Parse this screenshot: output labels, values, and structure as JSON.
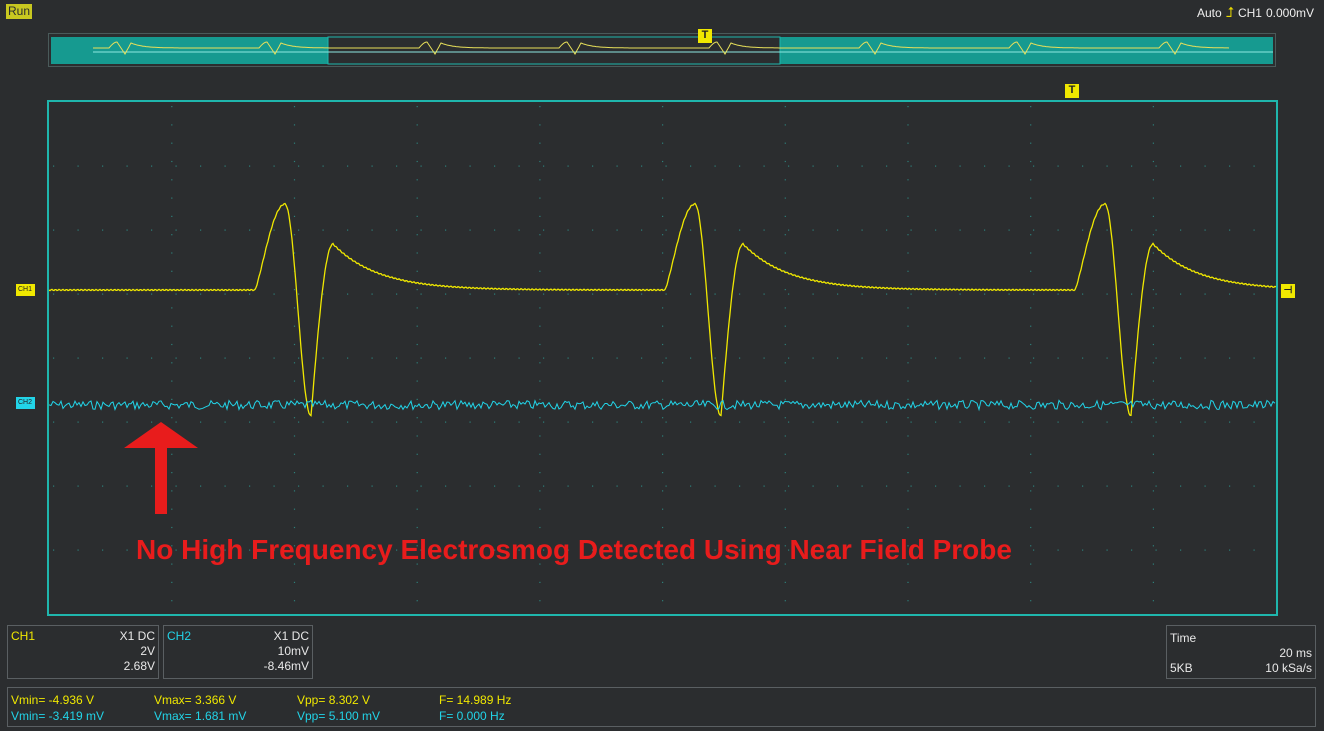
{
  "status": {
    "run_label": "Run"
  },
  "trigger": {
    "mode": "Auto",
    "source": "CH1",
    "level": "0.000mV",
    "marker_label": "T"
  },
  "channels": {
    "ch1": {
      "marker": "CH1",
      "color": "#f0e800"
    },
    "ch2": {
      "marker": "CH2",
      "color": "#22d4e8"
    }
  },
  "annotation": {
    "text": "No High Frequency Electrosmog Detected Using Near Field Probe",
    "color": "#e81c1c"
  },
  "panels": {
    "ch1": {
      "label": "CH1",
      "probe": "X1  DC",
      "scale": "2V",
      "offset": "2.68V"
    },
    "ch2": {
      "label": "CH2",
      "probe": "X1  DC",
      "scale": "10mV",
      "offset": "-8.46mV"
    },
    "time": {
      "label": "Time",
      "base": "20 ms",
      "memory": "5KB",
      "rate": "10 kSa/s"
    }
  },
  "measurements": {
    "ch1": {
      "vmin": "Vmin= -4.936 V",
      "vmax": "Vmax= 3.366 V",
      "vpp": "Vpp= 8.302 V",
      "freq": "F= 14.989 Hz"
    },
    "ch2": {
      "vmin": "Vmin= -3.419 mV",
      "vmax": "Vmax= 1.681 mV",
      "vpp": "Vpp= 5.100 mV",
      "freq": "F= 0.000 Hz"
    }
  },
  "icons": {
    "trigger_edge": "rising-edge-icon",
    "arrow": "arrow-up-icon"
  },
  "accent_colors": {
    "grid_border": "#1fb6ad",
    "background": "#2b2d2f"
  }
}
